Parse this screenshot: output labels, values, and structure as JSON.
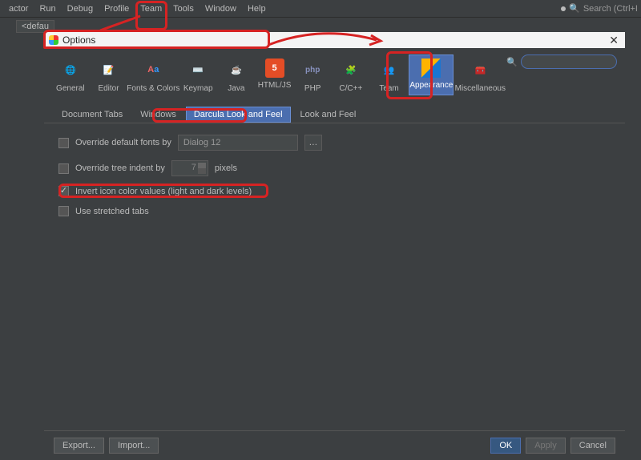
{
  "menubar": {
    "items": [
      "actor",
      "Run",
      "Debug",
      "Profile",
      "Team",
      "Tools",
      "Window",
      "Help"
    ],
    "search_placeholder": "Search (Ctrl+I"
  },
  "toolrow": {
    "combo": "<defau"
  },
  "dialog": {
    "title": "Options",
    "categories": [
      {
        "label": "General"
      },
      {
        "label": "Editor"
      },
      {
        "label": "Fonts & Colors"
      },
      {
        "label": "Keymap"
      },
      {
        "label": "Java"
      },
      {
        "label": "HTML/JS"
      },
      {
        "label": "PHP"
      },
      {
        "label": "C/C++"
      },
      {
        "label": "Team"
      },
      {
        "label": "Appearance"
      },
      {
        "label": "Miscellaneous"
      }
    ],
    "tabs": [
      "Document Tabs",
      "Windows",
      "Darcula Look and Feel",
      "Look and Feel"
    ],
    "opts": {
      "override_fonts": "Override default fonts by",
      "font_value": "Dialog 12",
      "override_indent": "Override tree indent by",
      "indent_value": "7",
      "indent_unit": "pixels",
      "invert": "Invert icon color values (light and dark levels)",
      "stretched": "Use stretched tabs"
    },
    "footer": {
      "export": "Export...",
      "import": "Import...",
      "ok": "OK",
      "apply": "Apply",
      "cancel": "Cancel"
    }
  }
}
